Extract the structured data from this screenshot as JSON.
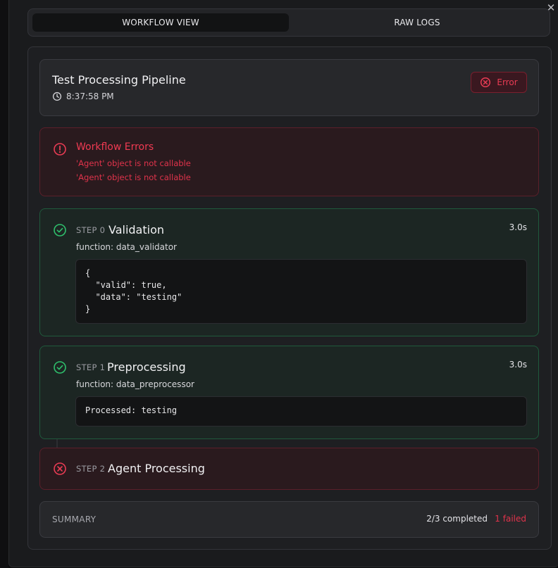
{
  "window": {
    "close_glyph": "✕"
  },
  "tabs": [
    {
      "label": "WORKFLOW VIEW",
      "active": true
    },
    {
      "label": "RAW LOGS",
      "active": false
    }
  ],
  "workflow": {
    "title": "Test Processing Pipeline",
    "time": "8:37:58 PM",
    "status": {
      "label": "Error",
      "icon": "x-circle-icon",
      "color": "#ea3c54"
    }
  },
  "errors": {
    "title": "Workflow Errors",
    "icon": "alert-circle-icon",
    "lines": [
      "'Agent' object is not callable",
      "'Agent' object is not callable"
    ]
  },
  "steps": [
    {
      "num_label": "STEP 0",
      "name": "Validation",
      "function": "function: data_validator",
      "duration": "3.0s",
      "status": "success",
      "icon": "check-circle-icon",
      "output": "{\n  \"valid\": true,\n  \"data\": \"testing\"\n}"
    },
    {
      "num_label": "STEP 1",
      "name": "Preprocessing",
      "function": "function: data_preprocessor",
      "duration": "3.0s",
      "status": "success",
      "icon": "check-circle-icon",
      "output": "Processed: testing"
    },
    {
      "num_label": "STEP 2",
      "name": "Agent Processing",
      "status": "failed",
      "icon": "x-circle-icon"
    }
  ],
  "summary": {
    "label": "SUMMARY",
    "completed": "2/3 completed",
    "failed": "1 failed"
  },
  "colors": {
    "success": "#2fbf6c",
    "error": "#ea3c54"
  }
}
